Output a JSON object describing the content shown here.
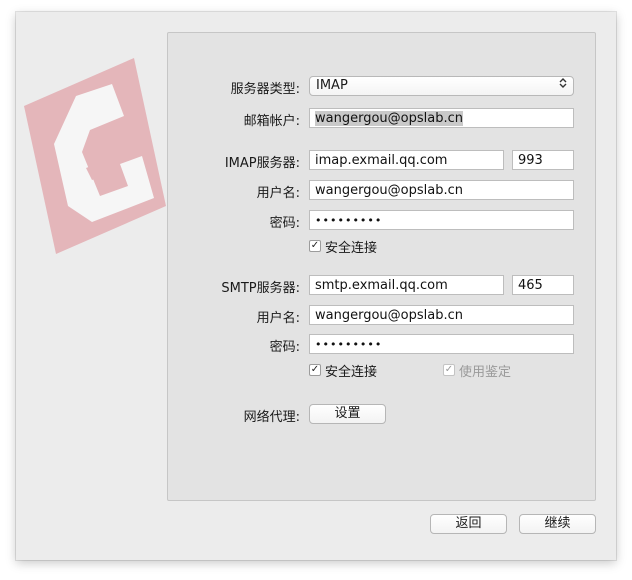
{
  "form": {
    "server_type": {
      "label": "服务器类型:",
      "value": "IMAP"
    },
    "email_account": {
      "label": "邮箱帐户:",
      "value": "wangergou@opslab.cn"
    },
    "imap": {
      "server_label": "IMAP服务器:",
      "server": "imap.exmail.qq.com",
      "port": "993",
      "username_label": "用户名:",
      "username": "wangergou@opslab.cn",
      "password_label": "密码:",
      "password_mask": "•••••••••",
      "secure_label": "安全连接",
      "secure_checked": true
    },
    "smtp": {
      "server_label": "SMTP服务器:",
      "server": "smtp.exmail.qq.com",
      "port": "465",
      "username_label": "用户名:",
      "username": "wangergou@opslab.cn",
      "password_label": "密码:",
      "password_mask": "•••••••••",
      "secure_label": "安全连接",
      "secure_checked": true,
      "auth_label": "使用鉴定",
      "auth_checked": true,
      "auth_disabled": true
    },
    "proxy": {
      "label": "网络代理:",
      "button": "设置"
    }
  },
  "footer": {
    "back_label": "返回",
    "continue_label": "继续"
  },
  "glyphs": {
    "check": "✓",
    "chevron": "⌃⌄"
  },
  "colors": {
    "logo": "#e9a3ab",
    "window_bg": "#ececec",
    "panel_bg": "#e3e3e3"
  }
}
